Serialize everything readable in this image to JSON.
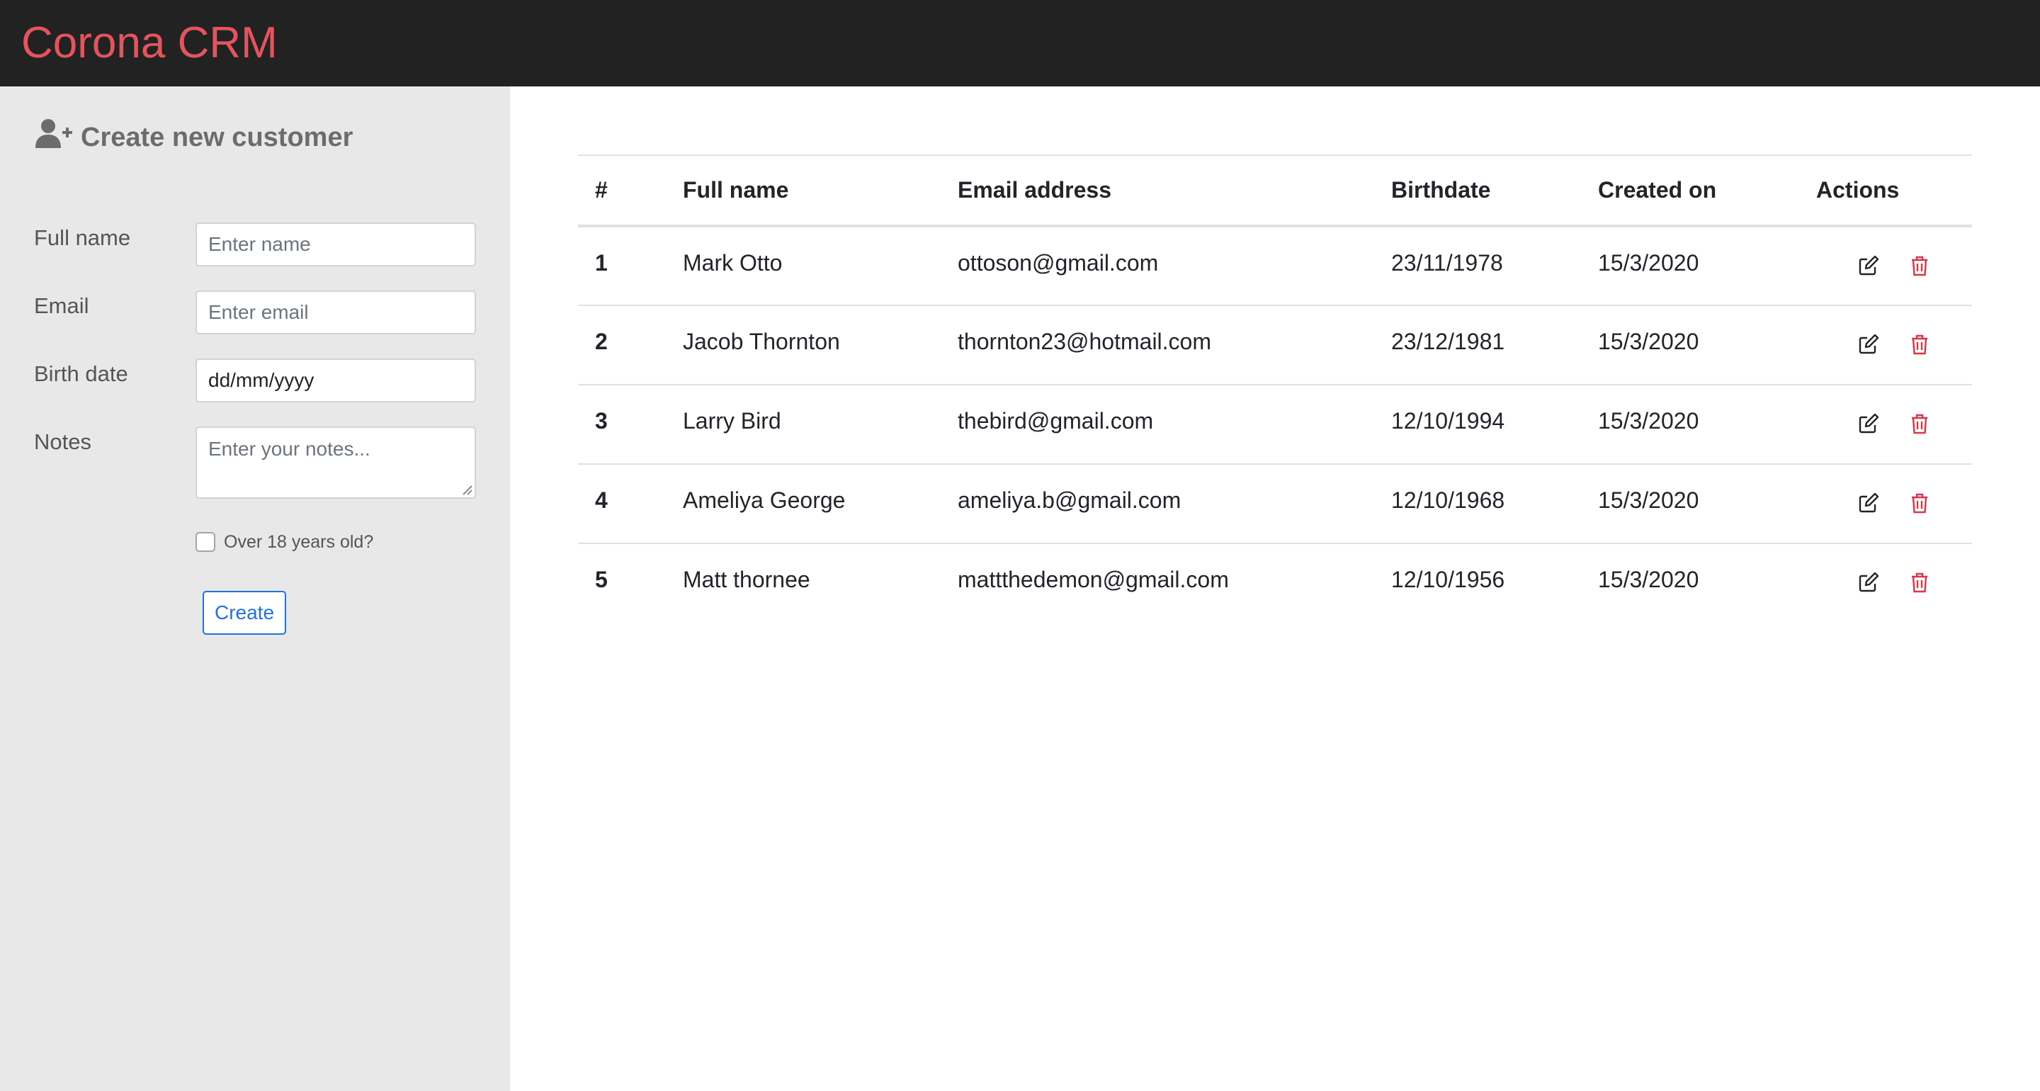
{
  "app": {
    "brand": "Corona CRM"
  },
  "form": {
    "title": "Create new customer",
    "fields": {
      "full_name": {
        "label": "Full name",
        "placeholder": "Enter name"
      },
      "email": {
        "label": "Email",
        "placeholder": "Enter email"
      },
      "birth_date": {
        "label": "Birth date",
        "value": "dd/mm/yyyy"
      },
      "notes": {
        "label": "Notes",
        "placeholder": "Enter your notes..."
      }
    },
    "over18_label": "Over 18 years old?",
    "create_label": "Create"
  },
  "table": {
    "headers": [
      "#",
      "Full name",
      "Email address",
      "Birthdate",
      "Created on",
      "Actions"
    ],
    "rows": [
      {
        "id": "1",
        "name": "Mark Otto",
        "email": "ottoson@gmail.com",
        "birthdate": "23/11/1978",
        "created": "15/3/2020"
      },
      {
        "id": "2",
        "name": "Jacob Thornton",
        "email": "thornton23@hotmail.com",
        "birthdate": "23/12/1981",
        "created": "15/3/2020"
      },
      {
        "id": "3",
        "name": "Larry Bird",
        "email": "thebird@gmail.com",
        "birthdate": "12/10/1994",
        "created": "15/3/2020"
      },
      {
        "id": "4",
        "name": "Ameliya George",
        "email": "ameliya.b@gmail.com",
        "birthdate": "12/10/1968",
        "created": "15/3/2020"
      },
      {
        "id": "5",
        "name": "Matt thornee",
        "email": "mattthedemon@gmail.com",
        "birthdate": "12/10/1956",
        "created": "15/3/2020"
      }
    ]
  },
  "icons": {
    "title": "user-plus-icon",
    "edit": "edit-icon",
    "delete": "trash-icon"
  },
  "colors": {
    "brand": "#e4545c",
    "topbar": "#222222",
    "sidebar": "#e8e8e8",
    "primary": "#1f73e0",
    "danger": "#dc3545"
  }
}
